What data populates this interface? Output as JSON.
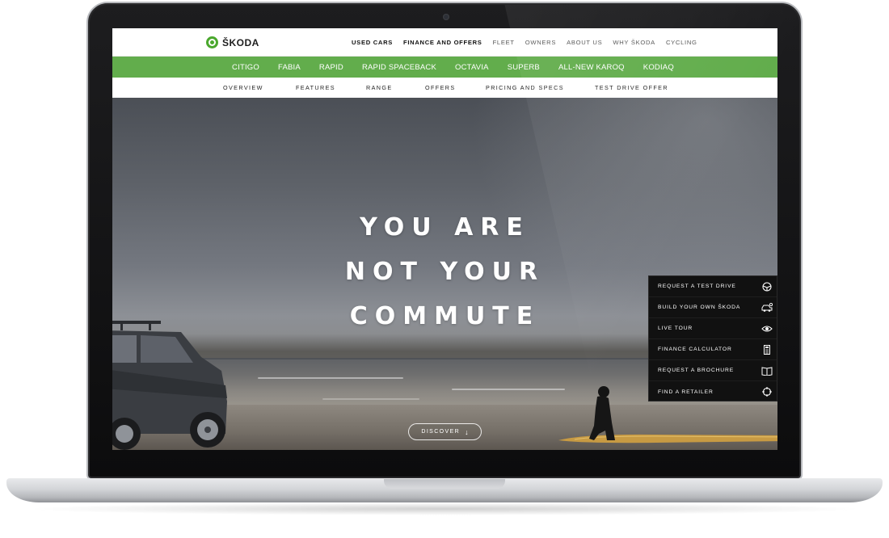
{
  "brand": {
    "logo_text": "ŠKODA",
    "accent_color": "#62ad4c"
  },
  "top_nav": {
    "links": [
      {
        "label": "USED CARS",
        "strong": true
      },
      {
        "label": "FINANCE AND OFFERS",
        "strong": true
      },
      {
        "label": "FLEET",
        "strong": false
      },
      {
        "label": "OWNERS",
        "strong": false
      },
      {
        "label": "ABOUT US",
        "strong": false
      },
      {
        "label": "WHY ŠKODA",
        "strong": false
      },
      {
        "label": "CYCLING",
        "strong": false
      }
    ]
  },
  "model_nav": {
    "items": [
      "CITIGO",
      "FABIA",
      "RAPID",
      "RAPID SPACEBACK",
      "OCTAVIA",
      "SUPERB",
      "ALL-NEW KAROQ",
      "KODIAQ"
    ]
  },
  "sub_nav": {
    "items": [
      "OVERVIEW",
      "FEATURES",
      "RANGE",
      "OFFERS",
      "PRICING AND SPECS",
      "TEST DRIVE OFFER"
    ]
  },
  "hero": {
    "headline_lines": [
      "YOU ARE",
      "NOT YOUR",
      "COMMUTE"
    ],
    "discover_label": "DISCOVER",
    "discover_icon": "arrow-down-icon"
  },
  "side_panel": {
    "items": [
      {
        "label": "REQUEST A TEST DRIVE",
        "icon": "steering-wheel-icon"
      },
      {
        "label": "BUILD YOUR OWN ŠKODA",
        "icon": "car-build-icon"
      },
      {
        "label": "LIVE TOUR",
        "icon": "eye-icon"
      },
      {
        "label": "FINANCE CALCULATOR",
        "icon": "calculator-icon"
      },
      {
        "label": "REQUEST A BROCHURE",
        "icon": "book-icon"
      },
      {
        "label": "FIND A RETAILER",
        "icon": "crosshair-icon"
      }
    ]
  }
}
